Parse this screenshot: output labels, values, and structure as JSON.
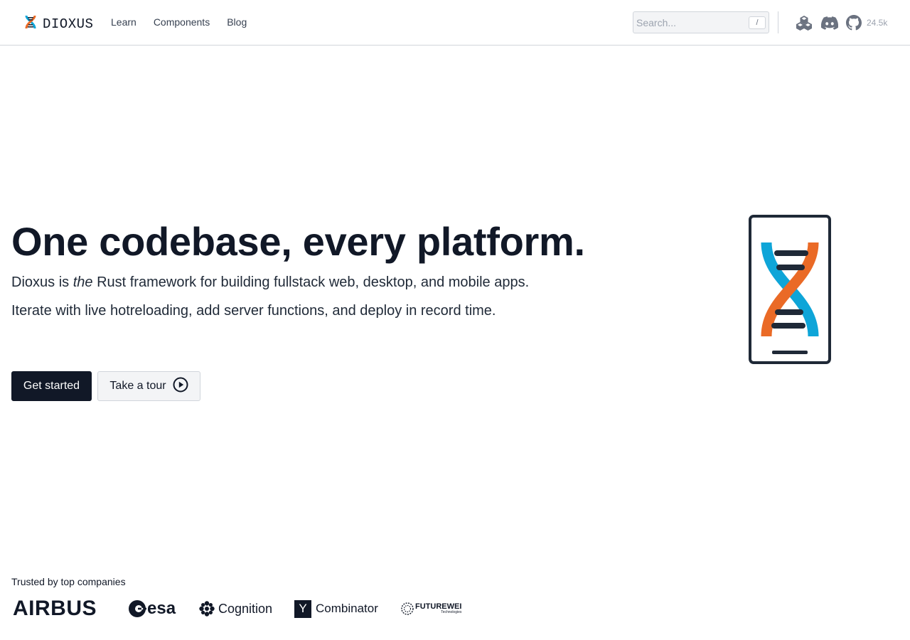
{
  "nav": {
    "brand": "DIOXUS",
    "links": [
      {
        "label": "Learn"
      },
      {
        "label": "Components"
      },
      {
        "label": "Blog"
      }
    ],
    "search": {
      "placeholder": "Search...",
      "shortcut": "/"
    },
    "icons": [
      "crates-icon",
      "discord-icon",
      "github-icon"
    ],
    "github_stars": "24.5k"
  },
  "hero": {
    "title": "One codebase, every platform.",
    "tagline_prefix": "Dioxus is ",
    "tagline_em": "the",
    "tagline_suffix": " Rust framework for building fullstack web, desktop, and mobile apps.",
    "subtitle": "Iterate with live hotreloading, add server functions, and deploy in record time.",
    "primary_button": "Get started",
    "secondary_button": "Take a tour"
  },
  "trusted": {
    "label": "Trusted by top companies",
    "companies": [
      {
        "name": "AIRBUS"
      },
      {
        "name": "esa"
      },
      {
        "name": "Cognition"
      },
      {
        "name": "Combinator",
        "mark": "Y"
      },
      {
        "name": "FUTUREWEI",
        "sub": "Technologies"
      }
    ]
  },
  "colors": {
    "dark": "#111827",
    "helix_blue": "#0ea5d8",
    "helix_orange": "#ea6a26",
    "border": "#d1d5db",
    "muted": "#9ca3af"
  }
}
